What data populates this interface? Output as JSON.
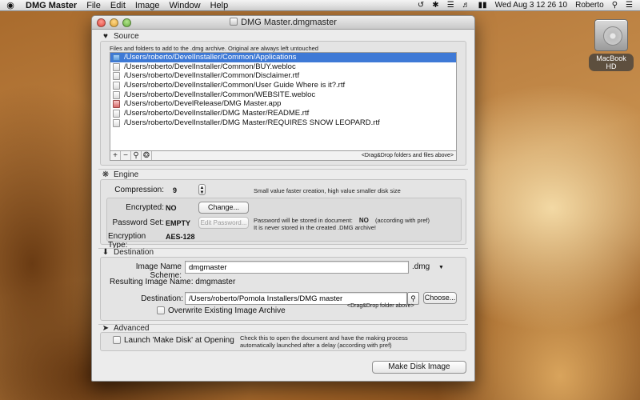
{
  "menubar": {
    "apple": "",
    "app_name": "DMG Master",
    "menus": [
      "File",
      "Edit",
      "Image",
      "Window",
      "Help"
    ],
    "clock": "Wed Aug 3  12 26 10",
    "user": "Roberto"
  },
  "desktop": {
    "drive_label": "MacBook HD"
  },
  "window": {
    "title": "DMG Master.dmgmaster",
    "source": {
      "heading": "Source",
      "description": "Files and folders to add to the .dmg archive. Original are always left untouched",
      "files": [
        {
          "path": "/Users/roberto/DevelInstaller/Common/Applications",
          "icon": "folder-icon",
          "selected": true
        },
        {
          "path": "/Users/roberto/DevelInstaller/Common/BUY.webloc",
          "icon": "file-icon"
        },
        {
          "path": "/Users/roberto/DevelInstaller/Common/Disclaimer.rtf",
          "icon": "file-icon"
        },
        {
          "path": "/Users/roberto/DevelInstaller/Common/User Guide Where is it?.rtf",
          "icon": "file-icon"
        },
        {
          "path": "/Users/roberto/DevelInstaller/Common/WEBSITE.webloc",
          "icon": "file-icon"
        },
        {
          "path": "/Users/roberto/DevelRelease/DMG Master.app",
          "icon": "app-icon"
        },
        {
          "path": "/Users/roberto/DevelInstaller/DMG Master/README.rtf",
          "icon": "file-icon"
        },
        {
          "path": "/Users/roberto/DevelInstaller/DMG Master/REQUIRES SNOW LEOPARD.rtf",
          "icon": "file-icon"
        }
      ],
      "buttons": {
        "add": "+",
        "remove": "−",
        "search": "🔍",
        "gear": "✲"
      },
      "drop_hint": "<Drag&Drop folders and files above>"
    },
    "engine": {
      "heading": "Engine",
      "compression_label": "Compression:",
      "compression_value": "9",
      "compression_hint": "Small value faster creation, high value smaller disk size",
      "encrypted_label": "Encrypted:",
      "encrypted_value": "NO",
      "change_button": "Change...",
      "password_label": "Password Set:",
      "password_value": "EMPTY",
      "edit_password_button": "Edit Password...",
      "password_note_1": "Password  will be stored in document:",
      "password_note_value": "NO",
      "password_note_suffix": "(according with pref)",
      "password_note_2": "It is never stored  in the created .DMG archive!",
      "encryption_type_label": "Encryption Type:",
      "encryption_type_value": "AES-128"
    },
    "destination": {
      "heading": "Destination",
      "scheme_label": "Image Name Scheme:",
      "scheme_value": "dmgmaster",
      "extension": ".dmg",
      "resulting_label": "Resulting Image Name:",
      "resulting_value": "dmgmaster",
      "destination_label": "Destination:",
      "destination_value": "/Users/roberto/Pomola Installers/DMG master",
      "choose_button": "Choose...",
      "drop_hint": "<Drag&Drop folder above>",
      "overwrite_label": "Overwrite Existing Image Archive"
    },
    "advanced": {
      "heading": "Advanced",
      "launch_label": "Launch 'Make Disk' at Opening",
      "launch_note_1": "Check this to open the document and have the making process",
      "launch_note_2": "automatically launched after a delay (according with pref)"
    },
    "make_button": "Make Disk Image"
  }
}
